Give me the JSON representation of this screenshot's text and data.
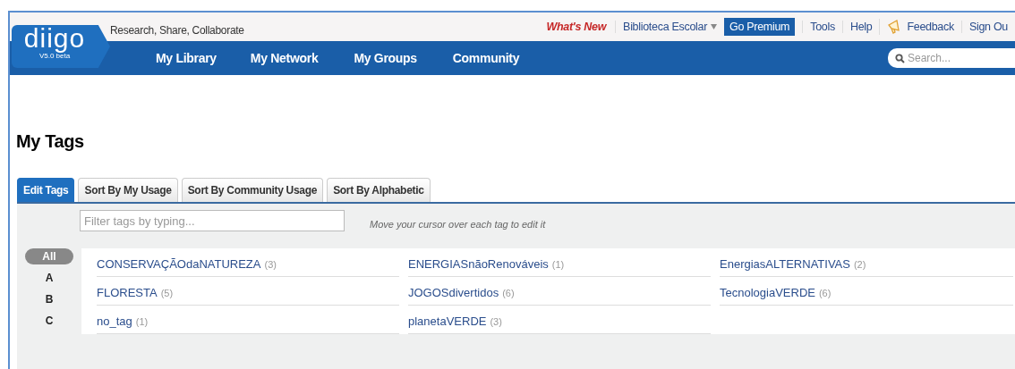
{
  "header": {
    "logo": "diigo",
    "version": "V5.0 beta",
    "tagline": "Research, Share, Collaborate",
    "top_links": [
      {
        "label": "What's New",
        "kind": "highlight"
      },
      {
        "label": "Biblioteca Escolar",
        "kind": "dropdown"
      },
      {
        "label": "Go Premium",
        "kind": "premium"
      },
      {
        "label": "Tools",
        "kind": "plain"
      },
      {
        "label": "Help",
        "kind": "plain"
      },
      {
        "label": "Feedback",
        "kind": "feedback"
      },
      {
        "label": "Sign Ou",
        "kind": "plain"
      }
    ],
    "nav": [
      "My Library",
      "My Network",
      "My Groups",
      "Community"
    ],
    "search": {
      "placeholder": "Search..."
    }
  },
  "page_title": "My Tags",
  "tabs": [
    {
      "label": "Edit Tags",
      "selected": true
    },
    {
      "label": "Sort By My Usage",
      "selected": false
    },
    {
      "label": "Sort By Community Usage",
      "selected": false
    },
    {
      "label": "Sort By Alphabetic",
      "selected": false
    }
  ],
  "filter": {
    "placeholder": "Filter tags by typing...",
    "hint": "Move your cursor over each tag to edit it"
  },
  "letters": [
    {
      "label": "All",
      "selected": true
    },
    {
      "label": "A",
      "selected": false
    },
    {
      "label": "B",
      "selected": false
    },
    {
      "label": "C",
      "selected": false
    }
  ],
  "tags": [
    {
      "name": "CONSERVAÇÃOdaNATUREZA",
      "count": "(3)"
    },
    {
      "name": "ENERGIASnãoRenováveis",
      "count": "(1)"
    },
    {
      "name": "EnergiasALTERNATIVAS",
      "count": "(2)"
    },
    {
      "name": "FLORESTA",
      "count": "(5)"
    },
    {
      "name": "JOGOSdivertidos",
      "count": "(6)"
    },
    {
      "name": "TecnologiaVERDE",
      "count": "(6)"
    },
    {
      "name": "no_tag",
      "count": "(1)"
    },
    {
      "name": "planetaVERDE",
      "count": "(3)"
    }
  ]
}
